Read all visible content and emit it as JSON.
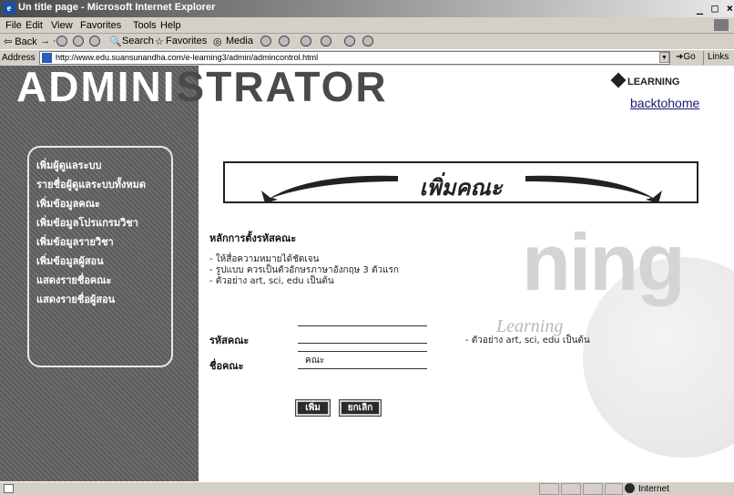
{
  "window": {
    "title": "Un title page - Microsoft Internet Explorer",
    "controls": "_ □ ×"
  },
  "menubar": {
    "items": [
      "File",
      "Edit",
      "View",
      "Favorites",
      "Tools",
      "Help"
    ]
  },
  "toolbar": {
    "back": "⇦ Back",
    "search": "Search",
    "favorites": "Favorites",
    "media": "Media"
  },
  "addressbar": {
    "label": "Address",
    "url": "http://www.edu.suansunandha.com/e-learning3/admin/admincontrol.html",
    "go": "Go",
    "links": "Links"
  },
  "page": {
    "banner_left": "ADMINI",
    "banner_right": "STRATOR",
    "brand": "LEARNING",
    "back_link": "backtohome",
    "header_title": "เพิ่มคณะ",
    "watermark_big": "ning",
    "watermark_small": "Learning"
  },
  "sidebar": {
    "items": [
      {
        "label": "เพิ่มผู้ดูแลระบบ"
      },
      {
        "label": "รายชื่อผู้ดูแลระบบทั้งหมด"
      },
      {
        "label": "เพิ่มข้อมูลคณะ"
      },
      {
        "label": "เพิ่มข้อมูลโปรแกรมวิชา"
      },
      {
        "label": "เพิ่มข้อมูลรายวิชา"
      },
      {
        "label": "เพิ่มข้อมูลผู้สอน"
      },
      {
        "label": "แสดงรายชื่อคณะ"
      },
      {
        "label": "แสดงรายชื่อผู้สอน"
      }
    ]
  },
  "form": {
    "rules_title": "หลักการตั้งรหัสคณะ",
    "rules": [
      "- ให้สื่อความหมายได้ชัดเจน",
      "- รูปแบบ ควรเป็นตัวอักษรภาษาอังกฤษ 3 ตัวแรก",
      "- ตัวอย่าง art, sci, edu เป็นต้น"
    ],
    "code_label": "รหัสคณะ",
    "code_value": "",
    "code_hint": "- ตัวอย่าง art, sci, edu เป็นต้น",
    "name_label": "ชื่อคณะ",
    "name_value": "คณะ",
    "submit_label": "เพิ่ม",
    "cancel_label": "ยกเลิก"
  },
  "statusbar": {
    "zone": "Internet"
  },
  "colors": {
    "sidebar_bg": "#5f5f5f",
    "titlebar_start": "#4a4a4a",
    "button_bg": "#2a2a2a",
    "link": "#1a1a6e"
  }
}
